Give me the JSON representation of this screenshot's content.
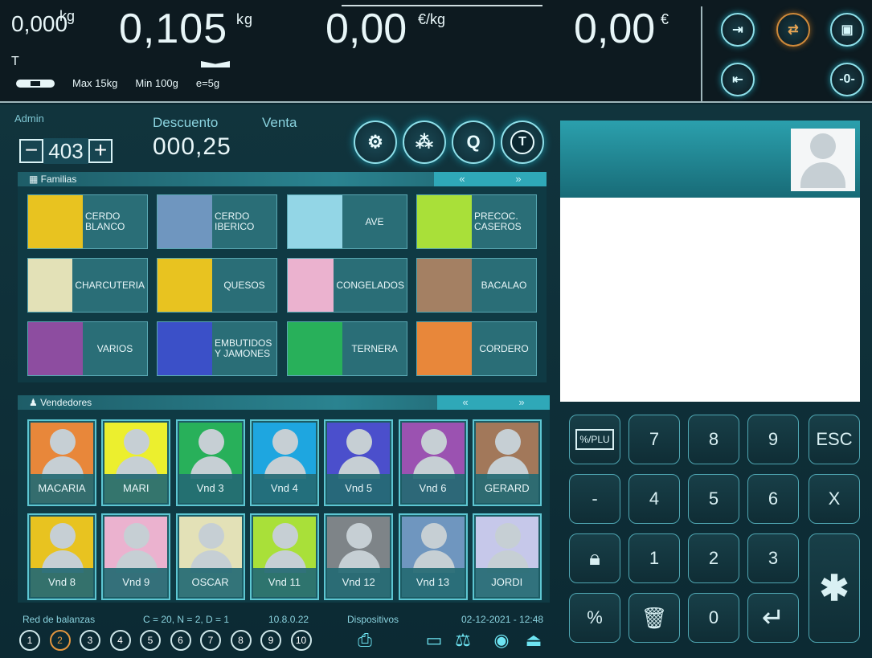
{
  "scale": {
    "tare_value": "0,000",
    "tare_unit": "kg",
    "tare_flag": "T",
    "weight_value": "0,105",
    "weight_unit": "kg",
    "price_value": "0,00",
    "price_unit": "€/kg",
    "total_value": "0,00",
    "total_unit": "€",
    "max": "Max 15kg",
    "min": "Min 100g",
    "e": "e=5g"
  },
  "top_icons": [
    "scale-in-icon",
    "scale-transfer-icon",
    "weight-box-icon",
    "scale-out-icon",
    "zero-icon"
  ],
  "operator": {
    "user": "Admin",
    "counter_value": "403",
    "minus": "−",
    "plus": "+",
    "descuento_label": "Descuento",
    "venta_label": "Venta",
    "discount_value": "000,25"
  },
  "actions": {
    "settings": "⚙",
    "network": "⁂",
    "search": "Q",
    "tare": "T"
  },
  "familias": {
    "title": "Familias",
    "prev": "«",
    "next": "»",
    "items": [
      {
        "label": "CERDO BLANCO",
        "color": "#e8c320"
      },
      {
        "label": "CERDO IBERICO",
        "color": "#6f96bf"
      },
      {
        "label": "AVE",
        "color": "#93d6e6"
      },
      {
        "label": "PRECOC. CASEROS",
        "color": "#a9e039"
      },
      {
        "label": "CHARCUTERIA",
        "color": "#e3e1b7"
      },
      {
        "label": "QUESOS",
        "color": "#e8c320"
      },
      {
        "label": "CONGELADOS",
        "color": "#ebb2cf"
      },
      {
        "label": "BACALAO",
        "color": "#a48063"
      },
      {
        "label": "VARIOS",
        "color": "#8d4da0"
      },
      {
        "label": "EMBUTIDOS Y JAMONES",
        "color": "#3b50c8"
      },
      {
        "label": "TERNERA",
        "color": "#28b05a"
      },
      {
        "label": "CORDERO",
        "color": "#e8873a"
      }
    ]
  },
  "vendedores": {
    "title": "Vendedores",
    "prev": "«",
    "next": "»",
    "items": [
      {
        "name": "MACARIA",
        "color": "#e8873a"
      },
      {
        "name": "MARI",
        "color": "#ecef2e"
      },
      {
        "name": "Vnd 3",
        "color": "#28b05a"
      },
      {
        "name": "Vnd 4",
        "color": "#1ea6e0"
      },
      {
        "name": "Vnd 5",
        "color": "#4b4fcc"
      },
      {
        "name": "Vnd 6",
        "color": "#9b52b1"
      },
      {
        "name": "GERARD",
        "color": "#a2785a"
      },
      {
        "name": "Vnd 8",
        "color": "#e8c320"
      },
      {
        "name": "Vnd 9",
        "color": "#ebb2cf"
      },
      {
        "name": "OSCAR",
        "color": "#e3e1b7"
      },
      {
        "name": "Vnd 11",
        "color": "#a9e039"
      },
      {
        "name": "Vnd 12",
        "color": "#7e8488"
      },
      {
        "name": "Vnd 13",
        "color": "#6f96bf"
      },
      {
        "name": "JORDI",
        "color": "#c6c8ea"
      }
    ]
  },
  "footer": {
    "network_label": "Red de balanzas",
    "network_params": "C = 20, N = 2, D = 1",
    "ip": "10.8.0.22",
    "devices_label": "Dispositivos",
    "datetime": "02-12-2021 - 12:48",
    "scales": [
      "1",
      "2",
      "3",
      "4",
      "5",
      "6",
      "7",
      "8",
      "9",
      "10"
    ],
    "selected_scale": "2"
  },
  "keypad": {
    "keys": [
      "7",
      "8",
      "9",
      "ESC",
      "-",
      "4",
      "5",
      "6",
      "X",
      "1",
      "2",
      "3",
      "%",
      "0"
    ],
    "plu_icon": "%/PLU",
    "star": "✱",
    "enter": "↵"
  }
}
